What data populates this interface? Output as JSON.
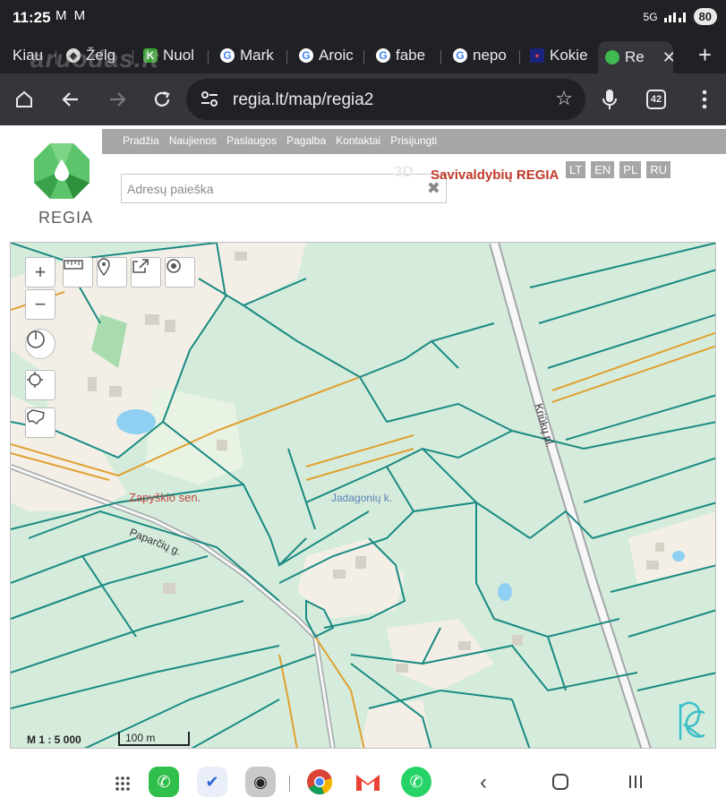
{
  "status": {
    "time": "11:25",
    "notifications": "M M",
    "network": "5G",
    "battery": "80"
  },
  "tabs": [
    {
      "label": "Kiau"
    },
    {
      "label": "Želg"
    },
    {
      "label": "Nuol"
    },
    {
      "label": "Mark"
    },
    {
      "label": "Aroic"
    },
    {
      "label": "fabe"
    },
    {
      "label": "nepo"
    },
    {
      "label": "Kokie"
    },
    {
      "label": "Re"
    }
  ],
  "watermark": "aruodas.lt",
  "toolbar": {
    "url": "regia.lt/map/regia2",
    "tab_count": "42"
  },
  "site": {
    "logo_text": "REGIA",
    "nav": [
      "Pradžia",
      "Naujienos",
      "Paslaugos",
      "Pagalba",
      "Kontaktai",
      "Prisijungti"
    ],
    "search_placeholder": "Adresų paieška",
    "label_3d": "3D",
    "title": "Savivaldybių REGIA",
    "languages": [
      "LT",
      "EN",
      "PL",
      "RU"
    ]
  },
  "map": {
    "labels": {
      "eldership": "Zapyškio sen.",
      "village": "Jadagonių k.",
      "street1": "Paparčių g.",
      "street2": "Kriūkų pl."
    },
    "scale_ratio": "M 1 : 5 000",
    "scale_bar": "100 m",
    "colors": {
      "parcel": "#1a8a82",
      "road": "#e0a030",
      "forest": "#d5ecdc",
      "built": "#f3efe7"
    }
  }
}
